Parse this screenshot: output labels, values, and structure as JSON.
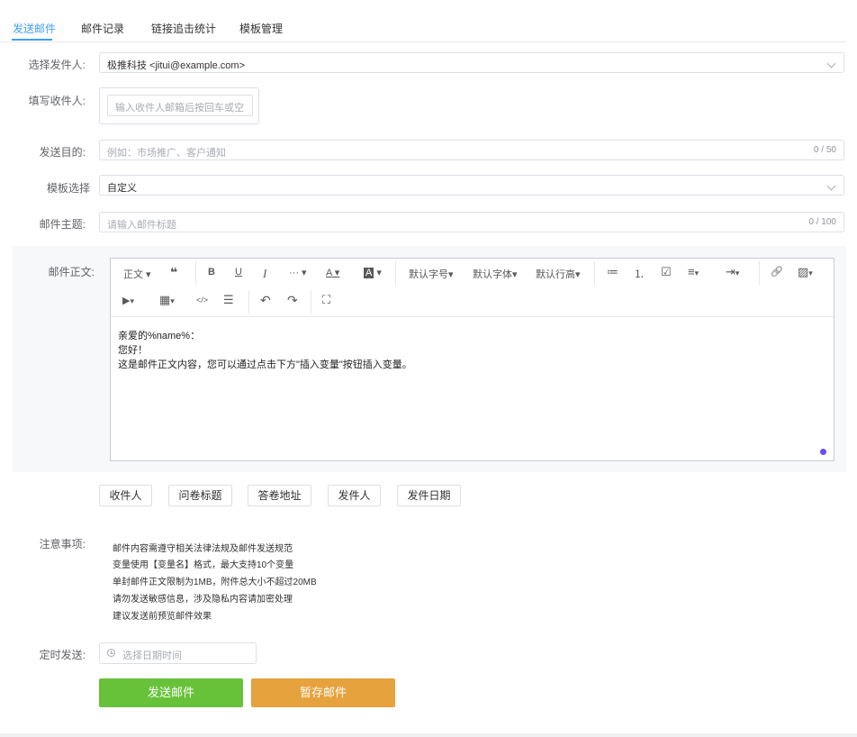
{
  "tabs": [
    "发送邮件",
    "邮件记录",
    "链接追击统计",
    "模板管理"
  ],
  "form": {
    "sender_label": "选择发件人:",
    "sender_value": "极推科技 <jitui@example.com>",
    "recipient_label": "填写收件人:",
    "recipient_placeholder": "输入收件人邮箱后按回车或空",
    "purpose_label": "发送目的:",
    "purpose_placeholder": "例如：市场推广、客户通知",
    "purpose_count": "0 / 50",
    "template_label": "模板选择",
    "template_value": "自定义",
    "subject_label": "邮件主题:",
    "subject_placeholder": "请输入邮件标题",
    "subject_count": "0 / 100",
    "body_label": "邮件正文:"
  },
  "toolbar": {
    "paragraph": "正文",
    "quote": "❝",
    "bold": "B",
    "underline": "U",
    "italic": "I",
    "more": "···",
    "font_color": "A",
    "bg_color": "A",
    "font_size": "默认字号",
    "font_family": "默认字体",
    "line_height": "默认行高",
    "bullet_list": "≔",
    "numbered_list": "⒈",
    "todo": "☑",
    "align": "≡",
    "indent": "⇥",
    "link": "🔗",
    "image": "▨",
    "video": "▶",
    "table": "▦",
    "code": "</>",
    "divider": "☰",
    "undo": "↶",
    "redo": "↷",
    "fullscreen": "⛶"
  },
  "editor_content": [
    "亲爱的%name%：",
    "您好！",
    "这是邮件正文内容，您可以通过点击下方\"插入变量\"按钮插入变量。"
  ],
  "variables": [
    "收件人",
    "问卷标题",
    "答卷地址",
    "发件人",
    "发件日期"
  ],
  "notes_label": "注意事项:",
  "notes": [
    "邮件内容需遵守相关法律法规及邮件发送规范",
    "变量使用【变量名】格式，最大支持10个变量",
    "单封邮件正文限制为1MB，附件总大小不超过20MB",
    "请勿发送敏感信息，涉及隐私内容请加密处理",
    "建议发送前预览邮件效果"
  ],
  "schedule_label": "定时发送:",
  "schedule_placeholder": "选择日期时间",
  "actions": {
    "send": "发送邮件",
    "save": "暂存邮件"
  },
  "colors": {
    "accent": "#409eff",
    "send": "#67c23a",
    "save": "#e6a23c"
  }
}
